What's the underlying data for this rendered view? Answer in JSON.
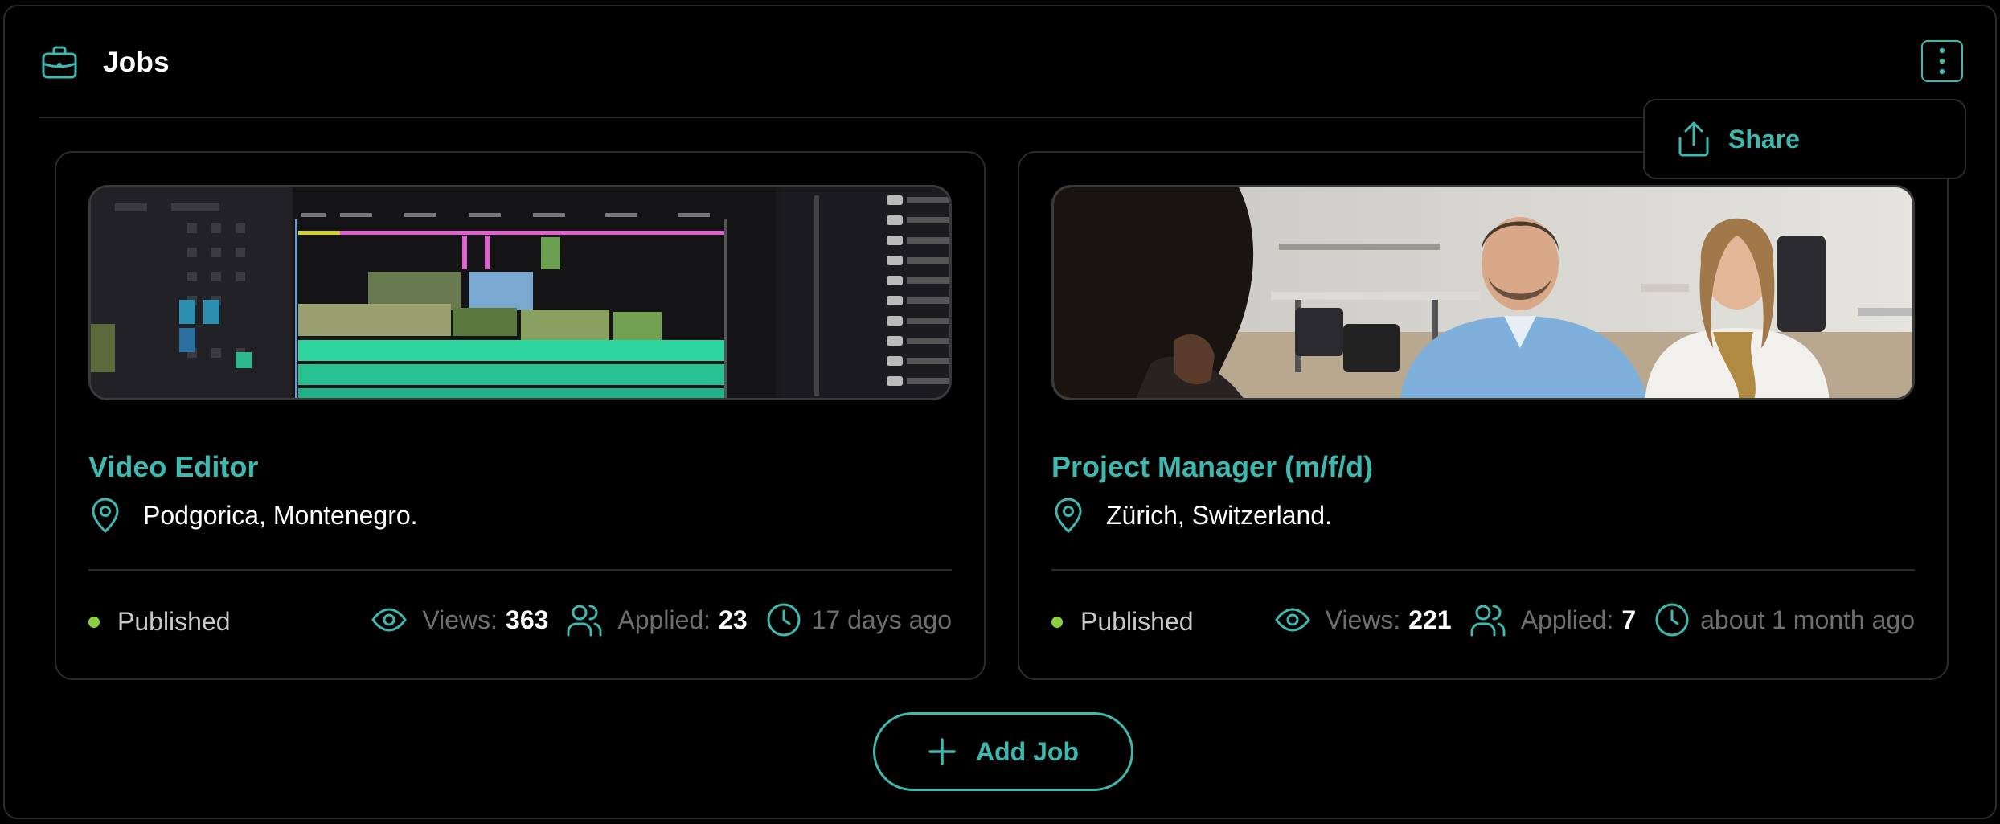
{
  "header": {
    "title": "Jobs",
    "icon": "briefcase-icon"
  },
  "menu": {
    "icon": "more-vertical-icon",
    "items": [
      {
        "label": "Share",
        "icon": "share-icon"
      }
    ]
  },
  "jobs": [
    {
      "title": "Video Editor",
      "location": "Podgorica, Montenegro.",
      "status": "Published",
      "views_label": "Views:",
      "views": "363",
      "applied_label": "Applied:",
      "applied": "23",
      "posted": "17 days ago",
      "image": "video-editing-timeline-image"
    },
    {
      "title": "Project Manager (m/f/d)",
      "location": "Zürich, Switzerland.",
      "status": "Published",
      "views_label": "Views:",
      "views": "221",
      "applied_label": "Applied:",
      "applied": "7",
      "posted": "about 1 month ago",
      "image": "office-meeting-photo"
    }
  ],
  "add_button": {
    "label": "Add Job",
    "icon": "plus-icon"
  },
  "colors": {
    "accent": "#3fb9b0",
    "status_published": "#8bd13f",
    "background": "#000000",
    "border": "#2a2a2a"
  }
}
